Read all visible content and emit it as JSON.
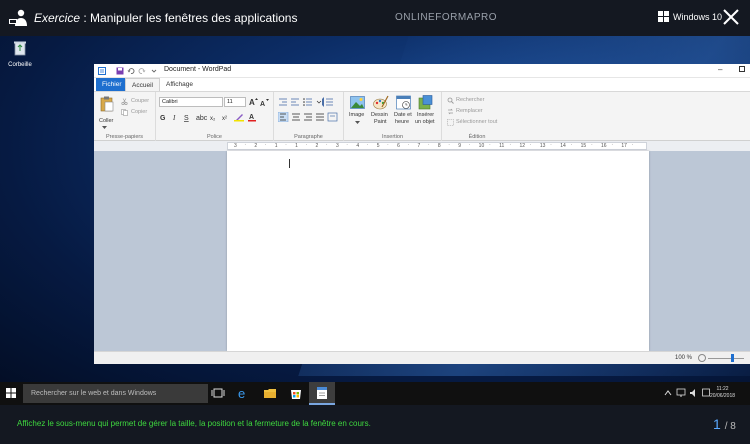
{
  "exercise": {
    "prefix": "Exercice",
    "separator": " : ",
    "title": "Manipuler les fenêtres des applications",
    "brand": "ONLINEFORMAPRO",
    "os_label": "Windows 10"
  },
  "desktop": {
    "recycle_bin_label": "Corbeille"
  },
  "wordpad": {
    "window_title": "Document - WordPad",
    "tabs": [
      {
        "label": "Fichier"
      },
      {
        "label": "Accueil"
      },
      {
        "label": "Affichage"
      }
    ],
    "clipboard": {
      "paste": "Coller",
      "cut": "Couper",
      "copy": "Copier",
      "group": "Presse-papiers"
    },
    "font": {
      "family": "Calibri",
      "size": "11",
      "group": "Police"
    },
    "paragraph": {
      "group": "Paragraphe"
    },
    "insert": {
      "image_1": "Image",
      "paint_1": "Dessin",
      "paint_2": "Paint",
      "date_1": "Date et",
      "date_2": "heure",
      "object_1": "Insérer",
      "object_2": "un objet",
      "group": "Insertion"
    },
    "editing": {
      "find": "Rechercher",
      "replace": "Remplacer",
      "select_all": "Sélectionner tout",
      "group": "Édition"
    },
    "ruler_marks": [
      "3",
      "2",
      "1",
      "1",
      "2",
      "3",
      "4",
      "5",
      "6",
      "7",
      "8",
      "9",
      "10",
      "11",
      "12",
      "13",
      "14",
      "15",
      "16",
      "17"
    ],
    "zoom": "100 %"
  },
  "taskbar": {
    "search_placeholder": "Rechercher sur le web et dans Windows",
    "time": "11:22",
    "date": "20/06/2018"
  },
  "instruction": {
    "text": "Affichez le sous-menu qui permet de gérer la taille, la position et la fermeture de la fenêtre en cours.",
    "current": "1",
    "total": "8"
  },
  "colors": {
    "accent": "#1e6fcf",
    "instruction_text": "#3fd93f",
    "counter": "#5aa8ff"
  }
}
